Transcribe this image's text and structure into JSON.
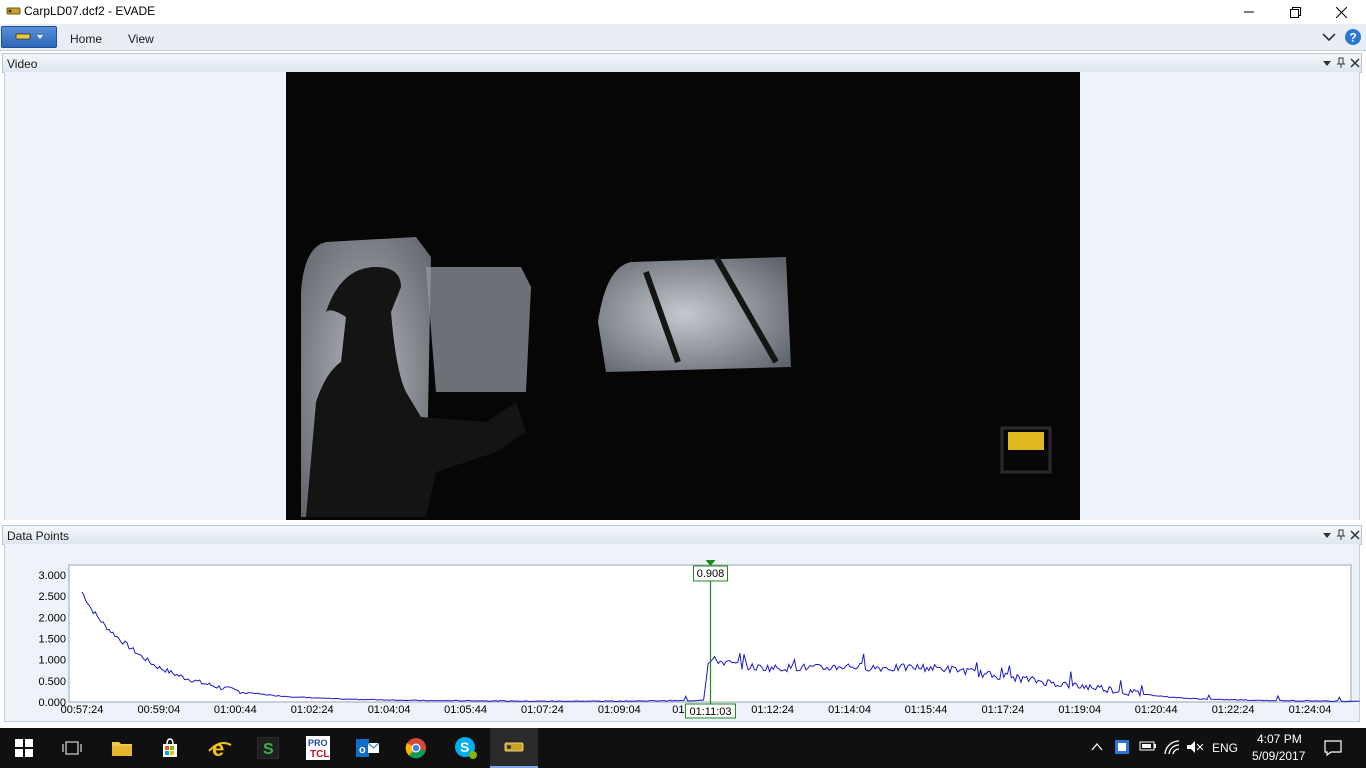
{
  "window": {
    "title": "CarpLD07.dcf2 - EVADE"
  },
  "ribbon": {
    "tabs": [
      "Home",
      "View"
    ]
  },
  "panels": {
    "video": {
      "title": "Video"
    },
    "data_points": {
      "title": "Data Points"
    }
  },
  "colors": {
    "series": "#1b1bc8",
    "cursor": "#1e8a1e",
    "accent": "#2b66b8"
  },
  "chart_data": {
    "type": "line",
    "ylim": [
      0,
      3.0
    ],
    "y_ticks": [
      "0.000",
      "0.500",
      "1.000",
      "1.500",
      "2.000",
      "2.500",
      "3.000"
    ],
    "x_ticks": [
      "00:57:24",
      "00:59:04",
      "01:00:44",
      "01:02:24",
      "01:04:04",
      "01:05:44",
      "01:07:24",
      "01:09:04",
      "01:11:03",
      "01:12:24",
      "01:14:04",
      "01:15:44",
      "01:17:24",
      "01:19:04",
      "01:20:44",
      "01:22:24",
      "01:24:04"
    ],
    "x_minutes": [
      57.4,
      59.07,
      60.73,
      62.4,
      64.07,
      65.73,
      67.4,
      69.07,
      71.05,
      72.4,
      74.07,
      75.73,
      77.4,
      79.07,
      80.73,
      82.4,
      84.07
    ],
    "series": [
      {
        "x": [
          57.4,
          57.6,
          57.9,
          58.2,
          58.6,
          59.0,
          59.5,
          60.0,
          60.5,
          61.0,
          61.5,
          62.0,
          63.0,
          64.0,
          65.0,
          66.0,
          67.0,
          68.0,
          69.0,
          70.0,
          70.6,
          70.9,
          71.0,
          71.1,
          71.3,
          71.6,
          72.0,
          72.5,
          73.0,
          73.5,
          74.0,
          74.5,
          75.0,
          75.5,
          76.0,
          76.5,
          77.0,
          77.5,
          78.0,
          78.5,
          79.0,
          79.5,
          80.0,
          80.5,
          81.0,
          81.5,
          82.0,
          82.5,
          83.0,
          83.5,
          84.0,
          84.5,
          85.0,
          85.15
        ],
        "values": [
          2.6,
          2.2,
          1.8,
          1.5,
          1.15,
          0.85,
          0.62,
          0.45,
          0.32,
          0.22,
          0.16,
          0.12,
          0.07,
          0.05,
          0.03,
          0.03,
          0.02,
          0.02,
          0.02,
          0.03,
          0.03,
          0.05,
          0.908,
          1.0,
          0.95,
          0.88,
          0.82,
          0.8,
          0.82,
          0.8,
          0.85,
          0.82,
          0.8,
          0.82,
          0.8,
          0.75,
          0.65,
          0.6,
          0.52,
          0.45,
          0.38,
          0.34,
          0.25,
          0.18,
          0.12,
          0.08,
          0.06,
          0.05,
          0.04,
          0.03,
          0.03,
          0.02,
          0.02,
          0.02
        ]
      }
    ],
    "cursor": {
      "time": "01:11:03",
      "x": 71.05,
      "value_label": "0.908"
    }
  },
  "taskbar": {
    "tray": {
      "language": "ENG",
      "time": "4:07 PM",
      "date": "5/09/2017"
    }
  }
}
